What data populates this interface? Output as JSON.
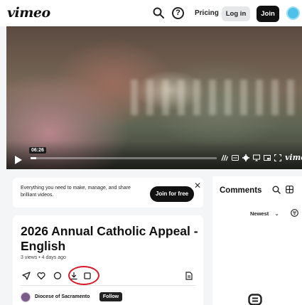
{
  "header": {
    "logo": "vimeo",
    "help_glyph": "?",
    "pricing": "Pricing",
    "login": "Log in",
    "join": "Join",
    "icons": {
      "search": "search-icon",
      "help": "help-icon",
      "avatar": "user-avatar"
    }
  },
  "player": {
    "timestamp": "06:26",
    "progress": 0.03,
    "brand": "vimeo",
    "controls": [
      "volume-icon",
      "captions-icon",
      "settings-icon",
      "cast-icon",
      "pip-icon",
      "fullscreen-icon"
    ]
  },
  "banner": {
    "text": "Everything you need to make, manage, and share brilliant videos.",
    "cta": "Join for free",
    "close": "✕"
  },
  "video": {
    "title": "2026 Annual Catholic Appeal - English",
    "meta": "3 views • 4 days ago",
    "actions": [
      "share-icon",
      "like-icon",
      "comment-icon",
      "download-icon",
      "collection-icon",
      "transcript-icon"
    ]
  },
  "channel": {
    "name": "Diocese of Sacramento",
    "follow": "Follow"
  },
  "comments": {
    "title": "Comments",
    "sort": "Newest",
    "sort_caret": "⌄"
  },
  "colors": {
    "accent": "#111111",
    "annotation_circle": "#d8192a",
    "avatar": "#4fc1e9"
  }
}
